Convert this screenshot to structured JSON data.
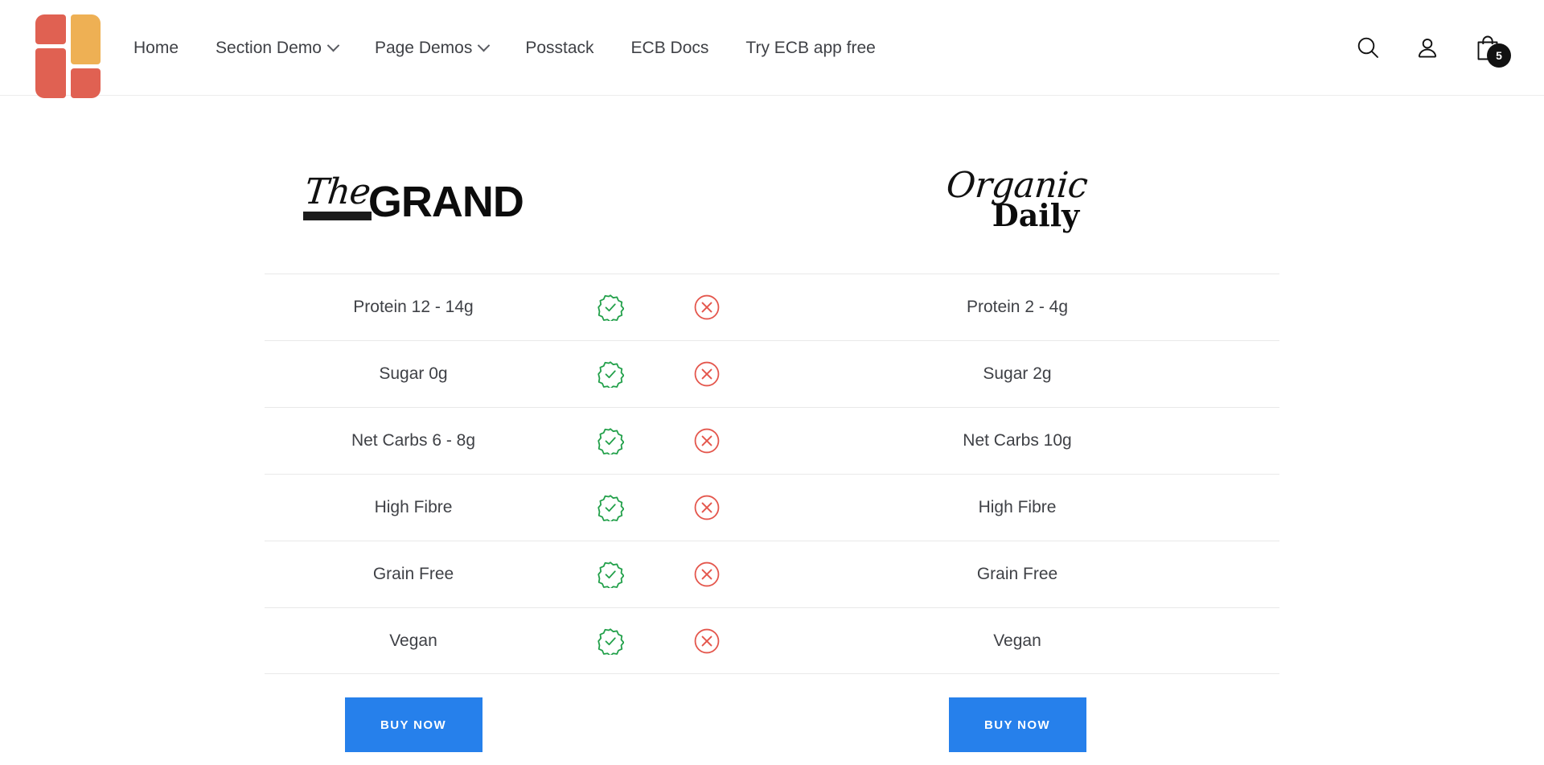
{
  "header": {
    "logo_name": "site-logo",
    "nav": [
      {
        "label": "Home",
        "has_dropdown": false
      },
      {
        "label": "Section Demo",
        "has_dropdown": true
      },
      {
        "label": "Page Demos",
        "has_dropdown": true
      },
      {
        "label": "Posstack",
        "has_dropdown": false
      },
      {
        "label": "ECB Docs",
        "has_dropdown": false
      },
      {
        "label": "Try ECB app free",
        "has_dropdown": false
      }
    ],
    "actions": {
      "search_label": "search-icon",
      "account_label": "account-icon",
      "cart_label": "cart-icon",
      "cart_count": "5"
    }
  },
  "compare": {
    "left_brand": {
      "script_text": "The",
      "bold_text": "GRAND"
    },
    "right_brand": {
      "script_text": "Organic",
      "bold_text": "Daily"
    },
    "rows": [
      {
        "left": "Protein 12 - 14g",
        "check": "check-badge",
        "cross": "cross-circle",
        "right": "Protein 2 - 4g"
      },
      {
        "left": "Sugar 0g",
        "check": "check-badge",
        "cross": "cross-circle",
        "right": "Sugar 2g"
      },
      {
        "left": "Net Carbs 6 - 8g",
        "check": "check-badge",
        "cross": "cross-circle",
        "right": "Net Carbs 10g"
      },
      {
        "left": "High Fibre",
        "check": "check-badge",
        "cross": "cross-circle",
        "right": "High Fibre"
      },
      {
        "left": "Grain Free",
        "check": "check-badge",
        "cross": "cross-circle",
        "right": "Grain Free"
      },
      {
        "left": "Vegan",
        "check": "check-badge",
        "cross": "cross-circle",
        "right": "Vegan"
      }
    ],
    "cta": {
      "left_label": "BUY NOW",
      "right_label": "BUY NOW"
    }
  },
  "colors": {
    "check_green": "#22a04a",
    "cross_red": "#e4564c",
    "button_blue": "#2680eb",
    "logo_red": "#e06152",
    "logo_yellow": "#eeb054",
    "divider": "#e9e9e9"
  }
}
